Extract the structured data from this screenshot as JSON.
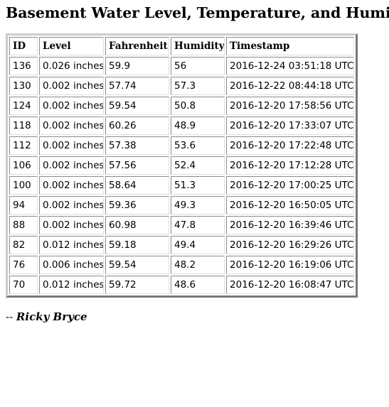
{
  "page": {
    "title": "Basement Water Level, Temperature, and Humidity"
  },
  "table": {
    "name": "basement-sensor-readings",
    "columns": [
      {
        "key": "id",
        "label": "ID"
      },
      {
        "key": "level",
        "label": "Level"
      },
      {
        "key": "fahrenheit",
        "label": "Fahrenheit"
      },
      {
        "key": "humidity",
        "label": "Humidity"
      },
      {
        "key": "timestamp",
        "label": "Timestamp"
      }
    ],
    "rows": [
      {
        "id": "136",
        "level": "0.026 inches",
        "fahrenheit": "59.9",
        "humidity": "56",
        "timestamp": "2016-12-24 03:51:18 UTC"
      },
      {
        "id": "130",
        "level": "0.002 inches",
        "fahrenheit": "57.74",
        "humidity": "57.3",
        "timestamp": "2016-12-22 08:44:18 UTC"
      },
      {
        "id": "124",
        "level": "0.002 inches",
        "fahrenheit": "59.54",
        "humidity": "50.8",
        "timestamp": "2016-12-20 17:58:56 UTC"
      },
      {
        "id": "118",
        "level": "0.002 inches",
        "fahrenheit": "60.26",
        "humidity": "48.9",
        "timestamp": "2016-12-20 17:33:07 UTC"
      },
      {
        "id": "112",
        "level": "0.002 inches",
        "fahrenheit": "57.38",
        "humidity": "53.6",
        "timestamp": "2016-12-20 17:22:48 UTC"
      },
      {
        "id": "106",
        "level": "0.002 inches",
        "fahrenheit": "57.56",
        "humidity": "52.4",
        "timestamp": "2016-12-20 17:12:28 UTC"
      },
      {
        "id": "100",
        "level": "0.002 inches",
        "fahrenheit": "58.64",
        "humidity": "51.3",
        "timestamp": "2016-12-20 17:00:25 UTC"
      },
      {
        "id": "94",
        "level": "0.002 inches",
        "fahrenheit": "59.36",
        "humidity": "49.3",
        "timestamp": "2016-12-20 16:50:05 UTC"
      },
      {
        "id": "88",
        "level": "0.002 inches",
        "fahrenheit": "60.98",
        "humidity": "47.8",
        "timestamp": "2016-12-20 16:39:46 UTC"
      },
      {
        "id": "82",
        "level": "0.012 inches",
        "fahrenheit": "59.18",
        "humidity": "49.4",
        "timestamp": "2016-12-20 16:29:26 UTC"
      },
      {
        "id": "76",
        "level": "0.006 inches",
        "fahrenheit": "59.54",
        "humidity": "48.2",
        "timestamp": "2016-12-20 16:19:06 UTC"
      },
      {
        "id": "70",
        "level": "0.012 inches",
        "fahrenheit": "59.72",
        "humidity": "48.6",
        "timestamp": "2016-12-20 16:08:47 UTC"
      }
    ]
  },
  "signature": {
    "dashes": "--",
    "author": "Ricky Bryce"
  },
  "colors": {
    "text": "#000000",
    "background": "#ffffff",
    "table_border": "#808080",
    "cell_border": "#c0c0c0"
  }
}
